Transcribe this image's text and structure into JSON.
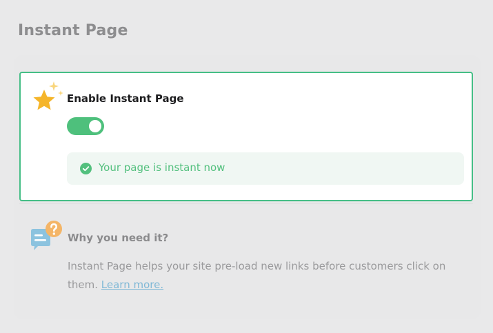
{
  "page": {
    "title": "Instant Page"
  },
  "feature": {
    "enable_label": "Enable Instant Page",
    "enabled": true,
    "status_text": "Your page is instant now"
  },
  "info": {
    "title": "Why you need it?",
    "description": "Instant Page helps your site pre-load new links before customers click on them.",
    "link_label": "Learn more."
  },
  "colors": {
    "accent": "#45be86",
    "toggle_on": "#4ec07c",
    "status_text": "#53c07e",
    "link": "#7fb8d6",
    "star": "#f5b52a",
    "question_badge": "#f4b567",
    "bubble": "#8cc3df"
  },
  "icons": {
    "feature": "star-icon",
    "status": "check-circle-icon",
    "info": "question-bubble-icon"
  }
}
